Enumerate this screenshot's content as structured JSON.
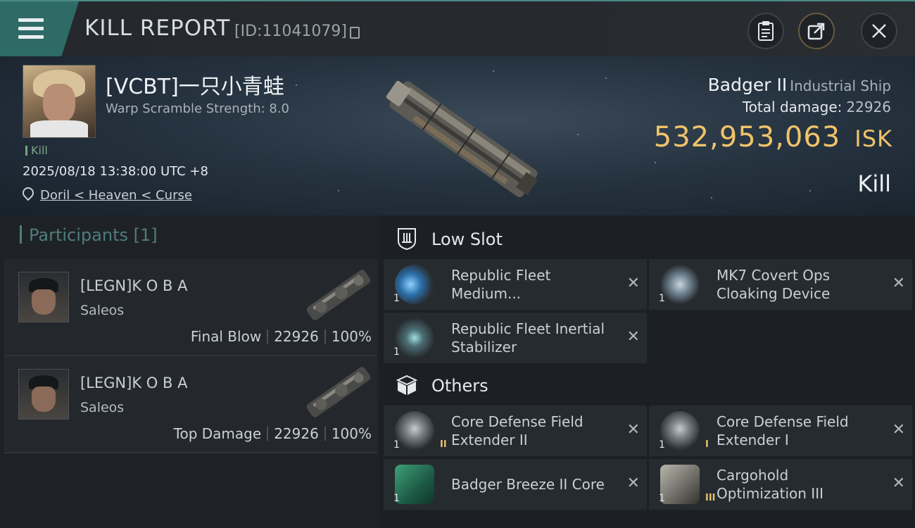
{
  "header": {
    "title": "KILL REPORT",
    "report_id": "[ID:11041079]"
  },
  "victim": {
    "name": "[VCBT]一只小青蛙",
    "warp_scramble": "Warp Scramble Strength: 8.0",
    "kill_tag": "Kill",
    "time": "2025/08/18 13:38:00 UTC +8",
    "location": "Doril < Heaven < Curse",
    "ship_name": "Badger II",
    "ship_class": "Industrial Ship",
    "total_damage_label": "Total damage:",
    "total_damage_value": "22926",
    "isk_value": "532,953,063",
    "isk_unit": "ISK",
    "result_label": "Kill"
  },
  "participants": {
    "header": "Participants [1]",
    "rows": [
      {
        "name": "[LEGN]K O B A",
        "ship": "Saleos",
        "role": "Final Blow",
        "damage": "22926",
        "percent": "100%"
      },
      {
        "name": "[LEGN]K O B A",
        "ship": "Saleos",
        "role": "Top Damage",
        "damage": "22926",
        "percent": "100%"
      }
    ]
  },
  "fitting": {
    "low_slot_label": "Low Slot",
    "others_label": "Others",
    "low_slot_items": [
      {
        "name": "Republic Fleet Medium...",
        "qty": "1"
      },
      {
        "name": "MK7 Covert Ops Cloaking Device",
        "qty": "1"
      },
      {
        "name": "Republic Fleet Inertial Stabilizer",
        "qty": "1"
      }
    ],
    "other_items": [
      {
        "name": "Core Defense Field Extender II",
        "qty": "1",
        "meta": "II"
      },
      {
        "name": "Core Defense Field Extender I",
        "qty": "1",
        "meta": "I"
      },
      {
        "name": "Badger Breeze II Core",
        "qty": "1"
      },
      {
        "name": "Cargohold Optimization III",
        "qty": "1",
        "meta": "III"
      }
    ],
    "close_symbol": "✕"
  },
  "colors": {
    "accent_teal": "#2e6b66",
    "isk_gold": "#f0c46a",
    "kill_green": "#6fa67a"
  }
}
